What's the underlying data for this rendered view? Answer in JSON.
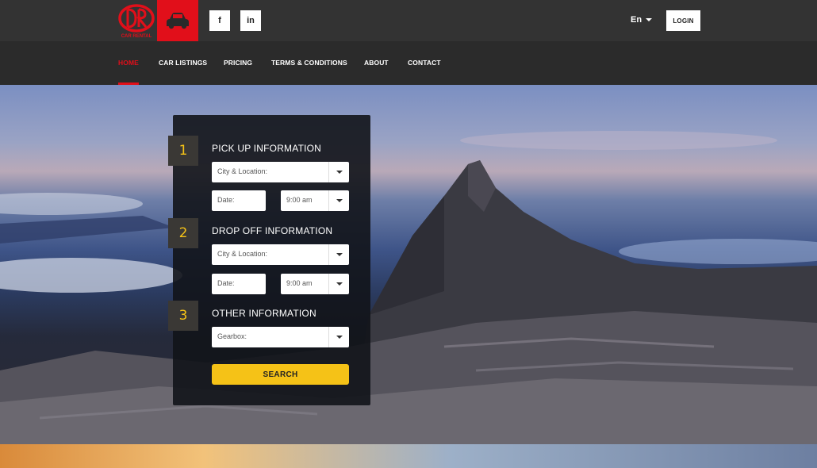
{
  "header": {
    "logo_text": "CAR RENTAL",
    "social": {
      "facebook": "f",
      "linkedin": "in"
    },
    "language": "En",
    "login_label": "LOGIN"
  },
  "nav": {
    "items": [
      {
        "label": "HOME",
        "active": true
      },
      {
        "label": "CAR LISTINGS",
        "active": false
      },
      {
        "label": "PRICING",
        "active": false
      },
      {
        "label": "TERMS & CONDITIONS",
        "active": false
      },
      {
        "label": "ABOUT",
        "active": false
      },
      {
        "label": "CONTACT",
        "active": false
      }
    ]
  },
  "booking": {
    "pickup": {
      "step": "1",
      "title": "PICK UP INFORMATION",
      "location_placeholder": "City & Location:",
      "date_placeholder": "Date:",
      "time_value": "9:00 am"
    },
    "dropoff": {
      "step": "2",
      "title": "DROP OFF INFORMATION",
      "location_placeholder": "City & Location:",
      "date_placeholder": "Date:",
      "time_value": "9:00 am"
    },
    "other": {
      "step": "3",
      "title": "OTHER INFORMATION",
      "gearbox_placeholder": "Gearbox:"
    },
    "search_label": "SEARCH"
  },
  "colors": {
    "brand_red": "#e10f1a",
    "accent_yellow": "#f5c217",
    "topbar_bg": "#333333",
    "nav_bg": "#2b2b2b"
  },
  "icons": [
    "car-rental-logo",
    "car-icon",
    "facebook-icon",
    "linkedin-icon",
    "chevron-down-icon"
  ]
}
